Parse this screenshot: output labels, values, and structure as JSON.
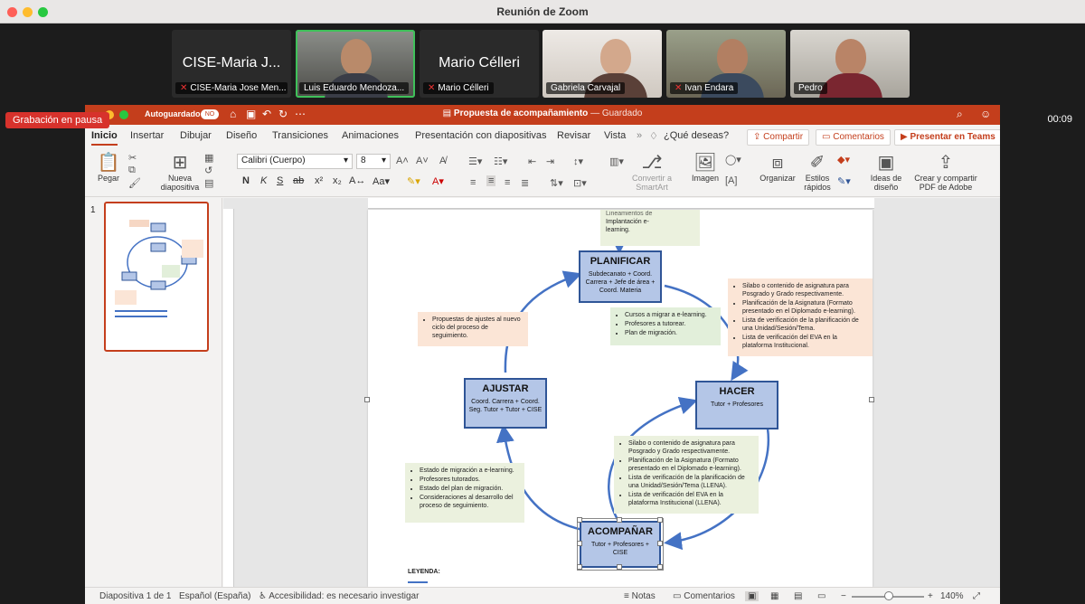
{
  "zoom": {
    "window_title": "Reunión de Zoom",
    "recording_badge": "Grabación en pausa",
    "timer": "00:09",
    "participants": [
      {
        "big_name": "CISE-Maria J...",
        "label": "CISE-Maria Jose Men...",
        "muted": true
      },
      {
        "big_name": "",
        "label": "Luis Eduardo Mendoza...",
        "muted": false
      },
      {
        "big_name": "Mario Célleri",
        "label": "Mario Célleri",
        "muted": true
      },
      {
        "big_name": "",
        "label": "Gabriela Carvajal",
        "muted": false
      },
      {
        "big_name": "",
        "label": "Ivan Endara",
        "muted": true
      },
      {
        "big_name": "",
        "label": "Pedro",
        "muted": false
      }
    ]
  },
  "ppt": {
    "autosave_label": "Autoguardado",
    "autosave_state": "NO",
    "doc_title": "Propuesta de acompañamiento",
    "doc_status": "— Guardado",
    "tabs": [
      "Inicio",
      "Insertar",
      "Dibujar",
      "Diseño",
      "Transiciones",
      "Animaciones",
      "Presentación con diapositivas",
      "Revisar",
      "Vista"
    ],
    "tell_me": "¿Qué deseas?",
    "share": "Compartir",
    "comments": "Comentarios",
    "teams": "Presentar en Teams",
    "ribbon": {
      "paste": "Pegar",
      "new_slide": "Nueva diapositiva",
      "font_name": "Calibri (Cuerpo)",
      "font_size": "8",
      "convert_smartart": "Convertir a SmartArt",
      "image": "Imagen",
      "organize": "Organizar",
      "quick_styles": "Estilos rápidos",
      "design_ideas": "Ideas de diseño",
      "adobe_pdf": "Crear y compartir PDF de Adobe"
    },
    "thumb_number": "1",
    "status": {
      "slide_count": "Diapositiva 1 de 1",
      "language": "Español (España)",
      "accessibility": "Accesibilidad: es necesario investigar",
      "notes": "Notas",
      "comments": "Comentarios",
      "zoom": "140%"
    }
  },
  "slide": {
    "top_note": [
      "Lineamientos de",
      "Implantación e-",
      "learning."
    ],
    "planificar": {
      "title": "PLANIFICAR",
      "sub": "Subdecanato + Coord. Carrera + Jefe de área + Coord. Materia"
    },
    "hacer": {
      "title": "HACER",
      "sub": "Tutor + Profesores"
    },
    "acompanar": {
      "title": "ACOMPAÑAR",
      "sub": "Tutor + Profesores + CISE"
    },
    "ajustar": {
      "title": "AJUSTAR",
      "sub": "Coord. Carrera + Coord. Seg. Tutor + Tutor + CISE"
    },
    "note_left_top": [
      "Propuestas de ajustes al nuevo ciclo del proceso de seguimiento."
    ],
    "note_center_top": [
      "Cursos a migrar a e-learning.",
      "Profesores a tutorear.",
      "Plan de migración."
    ],
    "note_right": [
      "Silabo o contenido de asignatura para Posgrado y Grado respectivamente.",
      "Planificación de la Asignatura (Formato presentado en el Diplomado e-learning).",
      "Lista de verificación de la planificación de una Unidad/Sesión/Tema.",
      "Lista de verificación del EVA en la plataforma Institucional."
    ],
    "note_center_bottom": [
      "Silabo o contenido de asignatura para Posgrado y Grado respectivamente.",
      "Planificación de la Asignatura (Formato presentado en el Diplomado e-learning).",
      "Lista de verificación de la planificación de una Unidad/Sesión/Tema (LLENA).",
      "Lista de verificación del EVA en la plataforma Institucional (LLENA)."
    ],
    "note_left_bottom": [
      "Estado de migración a e-learning.",
      "Profesores tutorados.",
      "Estado del plan de migración.",
      "Consideraciones al desarrollo del proceso de seguimiento."
    ],
    "legend": "LEYENDA:"
  }
}
